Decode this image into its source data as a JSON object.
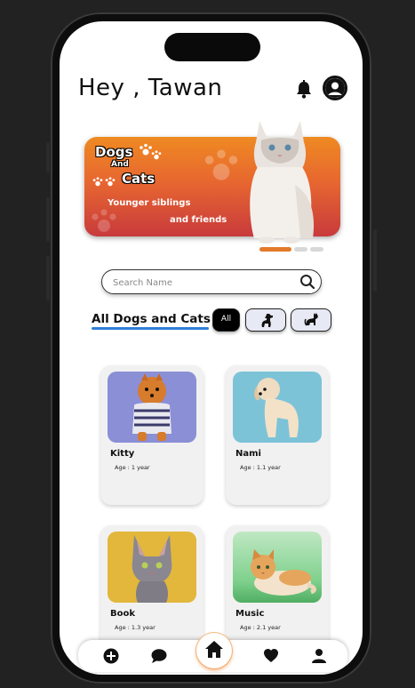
{
  "header": {
    "greeting": "Hey , Tawan",
    "notification_icon": "bell-icon",
    "profile_icon": "user-circle-icon"
  },
  "banner": {
    "title_line1": "Dogs",
    "title_line2": "And",
    "title_line3": "Cats",
    "subtitle_line1": "Younger siblings",
    "subtitle_line2": "and friends",
    "gradient_colors": [
      "#ef8a22",
      "#e76730",
      "#c83a3c"
    ],
    "carousel": {
      "pages": 3,
      "active_index": 0
    }
  },
  "search": {
    "placeholder": "Search Name",
    "value": "",
    "icon": "search-icon"
  },
  "filters": {
    "section_title": "All Dogs and Cats",
    "chips": [
      {
        "label": "All",
        "active": true
      },
      {
        "label": "",
        "icon": "dog-icon",
        "active": false
      },
      {
        "label": "",
        "icon": "cat-icon",
        "active": false
      }
    ]
  },
  "pets": [
    {
      "name": "Kitty",
      "age": "Age : 1 year",
      "photo_bg": "#8b8fd6"
    },
    {
      "name": "Nami",
      "age": "Age : 1.1 year",
      "photo_bg": "#7cc3d8"
    },
    {
      "name": "Book",
      "age": "Age : 1.3 year",
      "photo_bg": "#e2b73c"
    },
    {
      "name": "Music",
      "age": "Age : 2.1 year",
      "photo_bg": "#7fd08c"
    }
  ],
  "tabbar": {
    "items": [
      {
        "icon": "plus-circle-icon",
        "active": false
      },
      {
        "icon": "chat-icon",
        "active": false
      },
      {
        "icon": "home-icon",
        "active": true
      },
      {
        "icon": "heart-icon",
        "active": false
      },
      {
        "icon": "user-icon",
        "active": false
      }
    ]
  },
  "colors": {
    "accent_orange": "#e27a2a",
    "underline_blue": "#2f7fd6",
    "chip_bg": "#e7e9f5"
  }
}
